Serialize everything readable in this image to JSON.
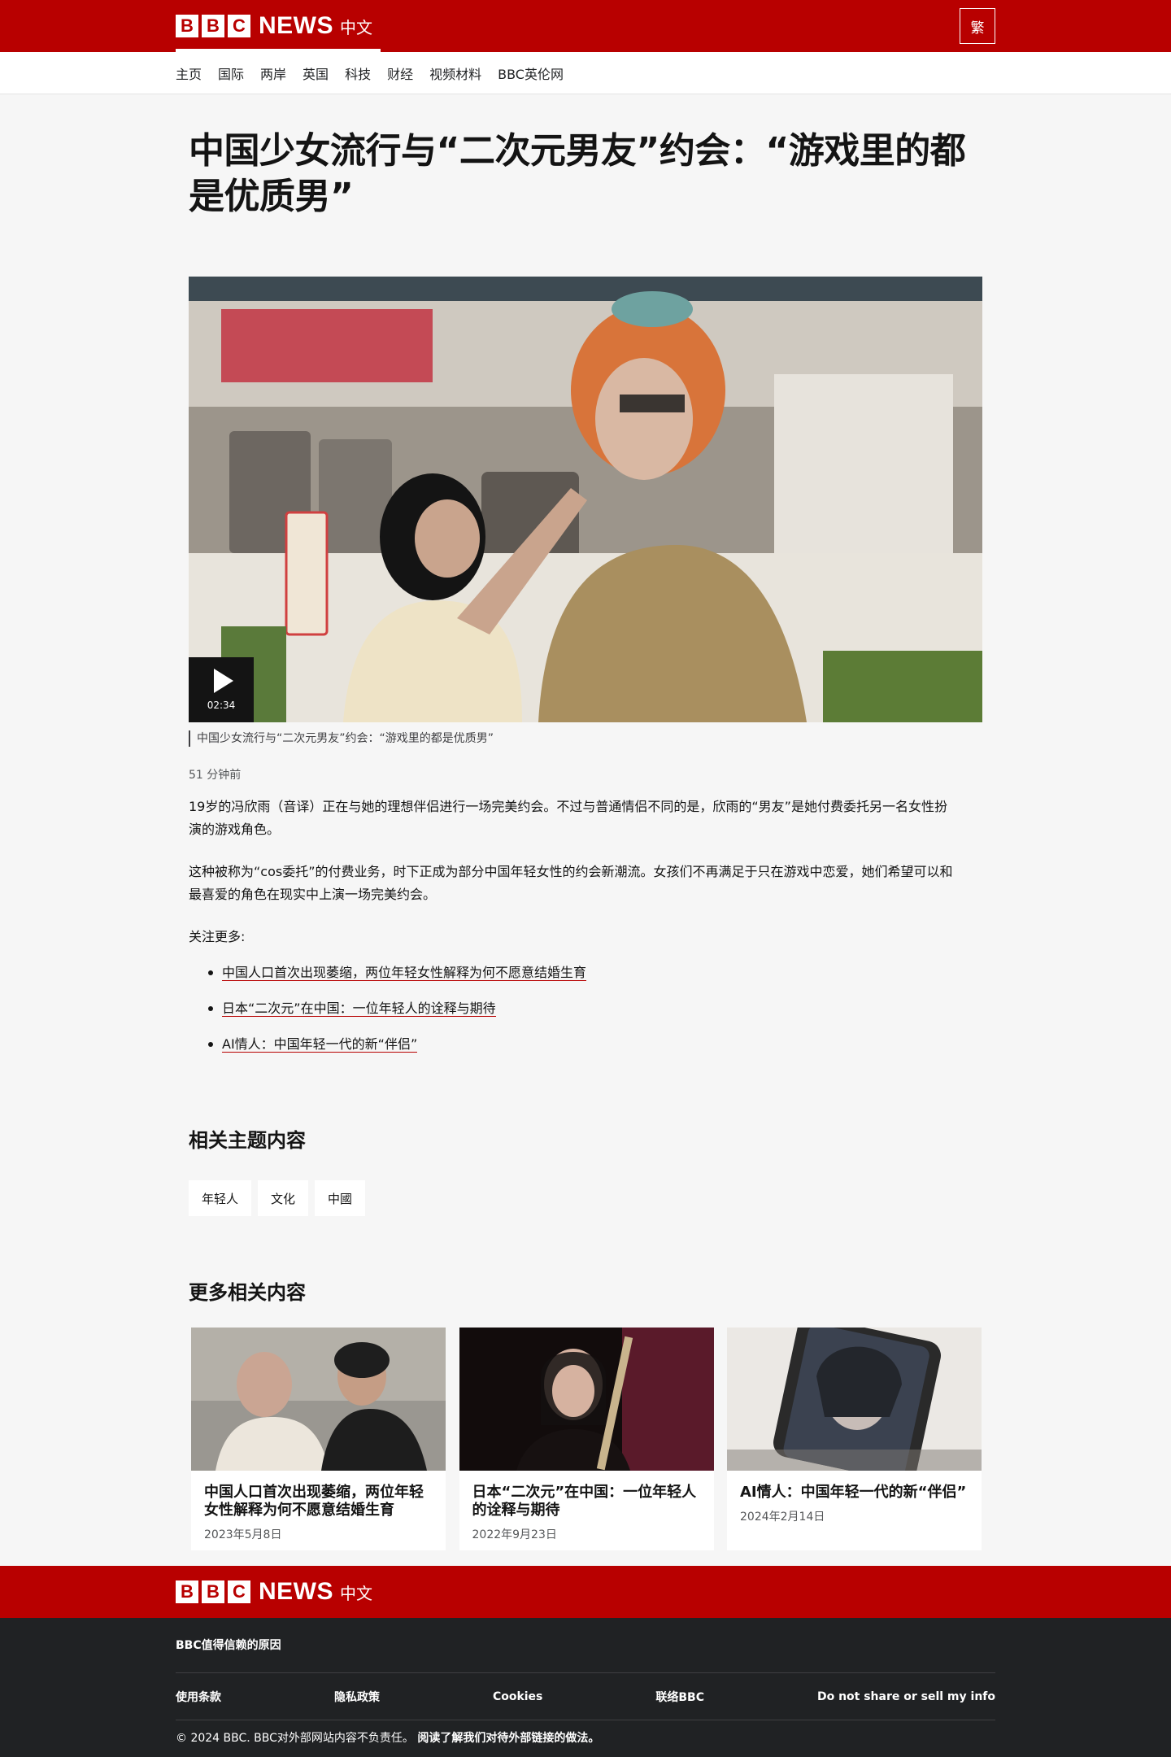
{
  "brand": {
    "letters": [
      "B",
      "B",
      "C"
    ],
    "news": "NEWS",
    "lang": "中文",
    "script_toggle": "繁"
  },
  "nav": [
    "主页",
    "国际",
    "两岸",
    "英国",
    "科技",
    "财经",
    "视频材料",
    "BBC英伦网"
  ],
  "article": {
    "headline": "中国少女流行与“二次元男友”约会：“游戏里的都是优质男”",
    "video_duration": "02:34",
    "caption": "中国少女流行与“二次元男友”约会：“游戏里的都是优质男”",
    "timestamp": "51 分钟前",
    "paragraphs": [
      "19岁的冯欣雨（音译）正在与她的理想伴侣进行一场完美约会。不过与普通情侣不同的是，欣雨的“男友”是她付费委托另一名女性扮演的游戏角色。",
      "这种被称为“cos委托”的付费业务，时下正成为部分中国年轻女性的约会新潮流。女孩们不再满足于只在游戏中恋爱，她们希望可以和最喜爱的角色在现实中上演一场完美约会。"
    ],
    "follow_label": "关注更多:",
    "related_links": [
      "中国人口首次出现萎缩，两位年轻女性解释为何不愿意结婚生育",
      "日本“二次元”在中国：一位年轻人的诠释与期待",
      "AI情人：中国年轻一代的新“伴侣”"
    ]
  },
  "topics": {
    "title": "相关主题内容",
    "items": [
      "年轻人",
      "文化",
      "中國"
    ]
  },
  "more": {
    "title": "更多相关内容",
    "cards": [
      {
        "title": "中国人口首次出现萎缩，两位年轻女性解释为何不愿意结婚生育",
        "date": "2023年5月8日"
      },
      {
        "title": "日本“二次元”在中国：一位年轻人的诠释与期待",
        "date": "2022年9月23日"
      },
      {
        "title": "AI情人：中国年轻一代的新“伴侣”",
        "date": "2024年2月14日"
      }
    ]
  },
  "footer": {
    "trust": "BBC值得信赖的原因",
    "links": [
      "使用条款",
      "隐私政策",
      "Cookies",
      "联络BBC",
      "Do not share or sell my info"
    ],
    "copyright": "© 2024 BBC. BBC对外部网站内容不负责任。",
    "external_policy": "阅读了解我们对待外部链接的做法。"
  },
  "colors": {
    "brand_red": "#b80000",
    "footer_dark": "#202224",
    "page_bg": "#f6f6f6"
  }
}
